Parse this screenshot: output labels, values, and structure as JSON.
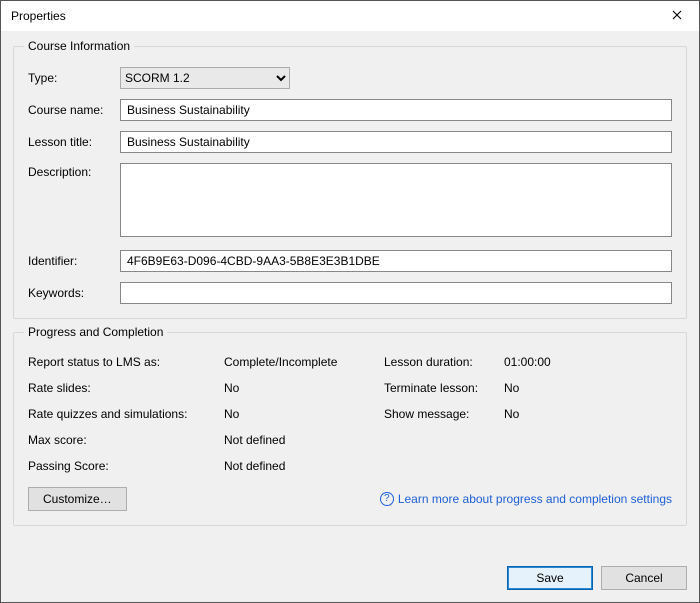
{
  "window": {
    "title": "Properties"
  },
  "courseInfo": {
    "legend": "Course Information",
    "typeLabel": "Type:",
    "typeValue": "SCORM 1.2",
    "courseNameLabel": "Course name:",
    "courseNameValue": "Business Sustainability",
    "lessonTitleLabel": "Lesson title:",
    "lessonTitleValue": "Business Sustainability",
    "descriptionLabel": "Description:",
    "descriptionValue": "",
    "identifierLabel": "Identifier:",
    "identifierValue": "4F6B9E63-D096-4CBD-9AA3-5B8E3E3B1DBE",
    "keywordsLabel": "Keywords:",
    "keywordsValue": ""
  },
  "progress": {
    "legend": "Progress and Completion",
    "reportStatusLabel": "Report status to LMS as:",
    "reportStatusValue": "Complete/Incomplete",
    "lessonDurationLabel": "Lesson duration:",
    "lessonDurationValue": "01:00:00",
    "rateSlidesLabel": "Rate slides:",
    "rateSlidesValue": "No",
    "terminateLessonLabel": "Terminate lesson:",
    "terminateLessonValue": "No",
    "rateQuizzesLabel": "Rate quizzes and simulations:",
    "rateQuizzesValue": "No",
    "showMessageLabel": "Show message:",
    "showMessageValue": "No",
    "maxScoreLabel": "Max score:",
    "maxScoreValue": "Not defined",
    "passingScoreLabel": "Passing Score:",
    "passingScoreValue": "Not defined",
    "customizeLabel": "Customize…",
    "learnMoreLabel": "Learn more about progress and completion settings"
  },
  "footer": {
    "save": "Save",
    "cancel": "Cancel"
  }
}
